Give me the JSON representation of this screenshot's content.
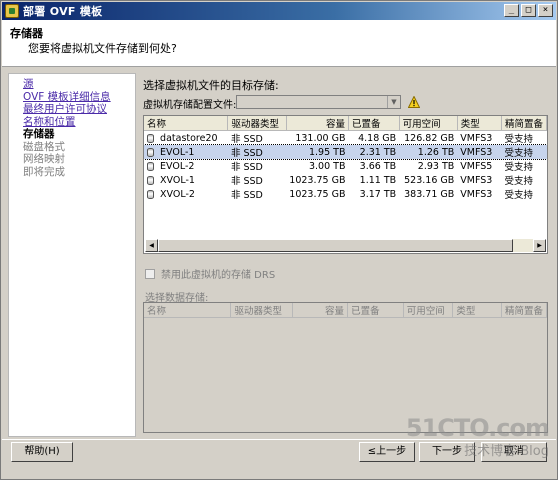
{
  "window": {
    "title": "部署 OVF 模板",
    "controls": [
      "_",
      "□",
      "×"
    ]
  },
  "header": {
    "title": "存储器",
    "subtitle": "您要将虚拟机文件存储到何处?"
  },
  "sidebar": {
    "items": [
      {
        "label": "源",
        "state": "link"
      },
      {
        "label": "OVF 模板详细信息",
        "state": "link"
      },
      {
        "label": "最终用户许可协议",
        "state": "link"
      },
      {
        "label": "名称和位置",
        "state": "link"
      },
      {
        "label": "存储器",
        "state": "current"
      },
      {
        "label": "磁盘格式",
        "state": "pending"
      },
      {
        "label": "网络映射",
        "state": "pending"
      },
      {
        "label": "即将完成",
        "state": "pending"
      }
    ]
  },
  "main": {
    "target_label": "选择虚拟机文件的目标存储:",
    "profile_label": "虚拟机存储配置文件:",
    "profile_value": "",
    "warning_icon": "warning-icon",
    "columns": [
      "名称",
      "驱动器类型",
      "容量",
      "已置备",
      "可用空间",
      "类型",
      "精简置备"
    ],
    "rows": [
      {
        "name": "datastore20",
        "drive": "非 SSD",
        "capacity": "131.00 GB",
        "provisioned": "4.18 GB",
        "free": "126.82 GB",
        "type": "VMFS3",
        "thin": "受支持",
        "selected": false
      },
      {
        "name": "EVOL-1",
        "drive": "非 SSD",
        "capacity": "1.95 TB",
        "provisioned": "2.31 TB",
        "free": "1.26 TB",
        "type": "VMFS3",
        "thin": "受支持",
        "selected": true
      },
      {
        "name": "EVOL-2",
        "drive": "非 SSD",
        "capacity": "3.00 TB",
        "provisioned": "3.66 TB",
        "free": "2.93 TB",
        "type": "VMFS5",
        "thin": "受支持",
        "selected": false
      },
      {
        "name": "XVOL-1",
        "drive": "非 SSD",
        "capacity": "1023.75 GB",
        "provisioned": "1.11 TB",
        "free": "523.16 GB",
        "type": "VMFS3",
        "thin": "受支持",
        "selected": false
      },
      {
        "name": "XVOL-2",
        "drive": "非 SSD",
        "capacity": "1023.75 GB",
        "provisioned": "3.17 TB",
        "free": "383.71 GB",
        "type": "VMFS3",
        "thin": "受支持",
        "selected": false
      }
    ],
    "drs_checkbox_label": "禁用此虚拟机的存储 DRS",
    "drs_checked": false,
    "select_datastore_label": "选择数据存储:",
    "second_columns": [
      "名称",
      "驱动器类型",
      "容量",
      "已置备",
      "可用空间",
      "类型",
      "精简置备"
    ]
  },
  "footer": {
    "help": "帮助(H)",
    "back": "≤上一步",
    "next": "下一步",
    "cancel": "取消"
  },
  "watermark": {
    "site": "51CTO.com",
    "tagline": "技术博客",
    "blog": "Blog"
  }
}
